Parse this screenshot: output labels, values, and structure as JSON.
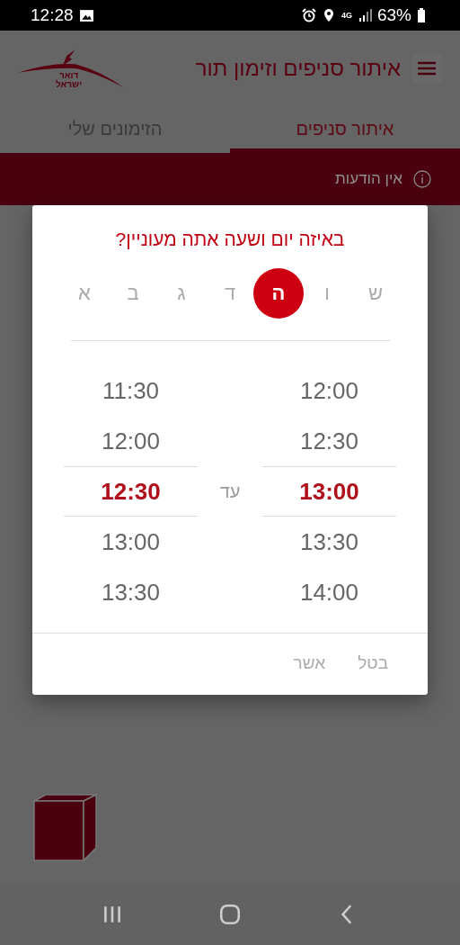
{
  "status_bar": {
    "time": "12:28",
    "network": "4G",
    "battery": "63%"
  },
  "app_bar": {
    "title": "איתור סניפים וזימון תור",
    "logo_lines": [
      "דואר",
      "ישראל"
    ]
  },
  "tabs": [
    {
      "label": "איתור סניפים",
      "selected": true
    },
    {
      "label": "הזימונים שלי",
      "selected": false
    }
  ],
  "notice": {
    "text": "אין הודעות"
  },
  "dialog": {
    "title": "באיזה יום ושעה אתה מעוניין?",
    "days": [
      {
        "label": "ש",
        "selected": false
      },
      {
        "label": "ו",
        "selected": false
      },
      {
        "label": "ה",
        "selected": true
      },
      {
        "label": "ד",
        "selected": false
      },
      {
        "label": "ג",
        "selected": false
      },
      {
        "label": "ב",
        "selected": false
      },
      {
        "label": "א",
        "selected": false
      }
    ],
    "time_columns": [
      {
        "times": [
          {
            "label": "12:00",
            "selected": false
          },
          {
            "label": "12:30",
            "selected": false
          },
          {
            "label": "13:00",
            "selected": true
          },
          {
            "label": "13:30",
            "selected": false
          },
          {
            "label": "14:00",
            "selected": false
          }
        ]
      },
      {
        "times": [
          {
            "label": "11:30",
            "selected": false
          },
          {
            "label": "12:00",
            "selected": false
          },
          {
            "label": "12:30",
            "selected": true
          },
          {
            "label": "13:00",
            "selected": false
          },
          {
            "label": "13:30",
            "selected": false
          }
        ]
      }
    ],
    "separator": "עד",
    "buttons": [
      "בטל",
      "אשר"
    ]
  }
}
